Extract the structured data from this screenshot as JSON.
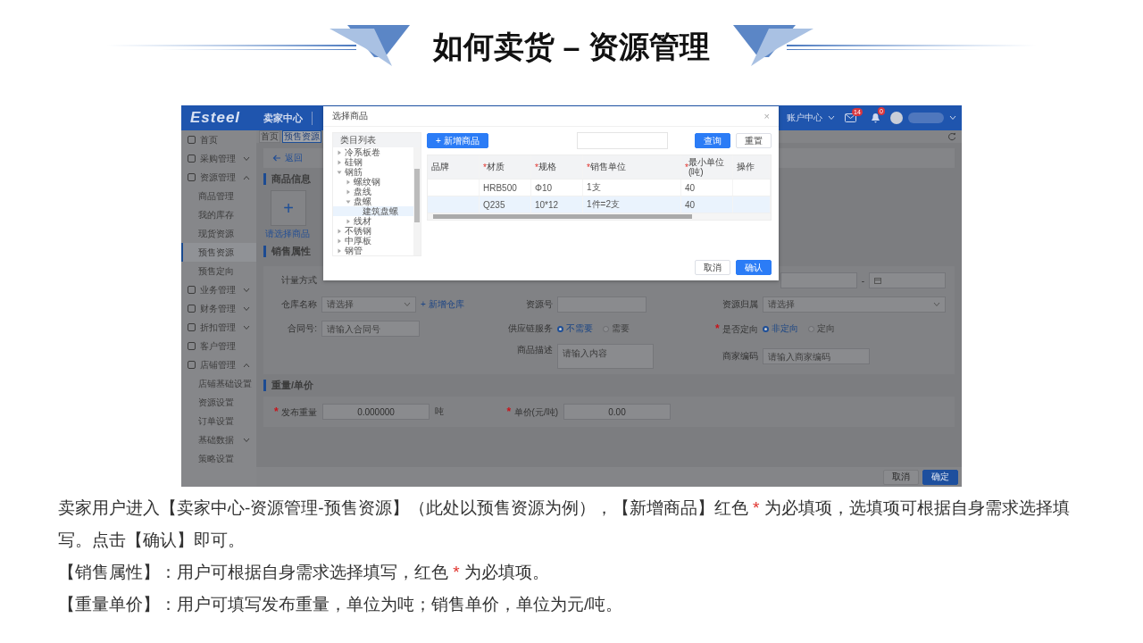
{
  "slide": {
    "title": "如何卖货 – 资源管理"
  },
  "app": {
    "topbar": {
      "logo": "Esteel",
      "center": "卖家中心",
      "account": "账户中心",
      "mail_badge": "14",
      "bell_badge": "0"
    },
    "tabs": [
      {
        "label": "首页",
        "selected": false
      },
      {
        "label": "预售资源",
        "selected": true
      }
    ],
    "sidebar": [
      {
        "label": "首页",
        "kind": "page"
      },
      {
        "label": "采购管理",
        "kind": "group",
        "expanded": false
      },
      {
        "label": "资源管理",
        "kind": "group",
        "expanded": true,
        "children": [
          {
            "label": "商品管理",
            "selected": false
          },
          {
            "label": "我的库存",
            "selected": false
          },
          {
            "label": "现货资源",
            "selected": false
          },
          {
            "label": "预售资源",
            "selected": true
          },
          {
            "label": "预售定向",
            "selected": false
          }
        ]
      },
      {
        "label": "业务管理",
        "kind": "group",
        "expanded": false
      },
      {
        "label": "财务管理",
        "kind": "group",
        "expanded": false
      },
      {
        "label": "折扣管理",
        "kind": "group",
        "expanded": false
      },
      {
        "label": "客户管理",
        "kind": "page"
      },
      {
        "label": "店铺管理",
        "kind": "group",
        "expanded": true,
        "children": [
          {
            "label": "店铺基础设置",
            "selected": false
          },
          {
            "label": "资源设置",
            "selected": false
          },
          {
            "label": "订单设置",
            "selected": false
          },
          {
            "label": "基础数据",
            "selected": false,
            "expanded": false
          },
          {
            "label": "策略设置",
            "selected": false
          }
        ]
      }
    ],
    "main": {
      "back": "返回",
      "section_goods": "商品信息",
      "add_card": {
        "symbol": "+",
        "label": "请选择商品"
      },
      "section_sales": "销售属性",
      "sales_form": {
        "measure_label": "计量方式",
        "date_range": {
          "separator": "-"
        },
        "warehouse": {
          "label": "仓库名称",
          "placeholder": "请选择",
          "link": "+ 新增仓库"
        },
        "resource_no": {
          "label": "资源号"
        },
        "resource_owner": {
          "label": "资源归属",
          "placeholder": "请选择"
        },
        "contract": {
          "label": "合同号:",
          "placeholder": "请输入合同号"
        },
        "supply": {
          "label": "供应链服务",
          "required": false,
          "options": [
            {
              "label": "不需要",
              "selected": true
            },
            {
              "label": "需要",
              "selected": false
            }
          ]
        },
        "directed": {
          "label": "是否定向",
          "required": true,
          "options": [
            {
              "label": "非定向",
              "selected": true
            },
            {
              "label": "定向",
              "selected": false
            }
          ]
        },
        "description": {
          "label": "商品描述",
          "placeholder": "请输入内容"
        },
        "merchant_code": {
          "label": "商家编码",
          "placeholder": "请输入商家编码"
        }
      },
      "section_weight": "重量/单价",
      "weight": {
        "label": "发布重量",
        "required": true,
        "value": "0.000000",
        "unit": "吨"
      },
      "price": {
        "label": "单价(元/吨)",
        "required": true,
        "value": "0.00"
      },
      "footer": [
        {
          "label": "取消",
          "kind": "secondary"
        },
        {
          "label": "确定",
          "kind": "primary"
        }
      ]
    },
    "dialog": {
      "title": "选择商品",
      "close": "×",
      "tree_header": "类目列表",
      "tree": [
        {
          "label": "冷系板卷",
          "kind": "branch",
          "expanded": false,
          "selected": false
        },
        {
          "label": "硅钢",
          "kind": "branch",
          "expanded": false,
          "selected": false
        },
        {
          "label": "钢筋",
          "kind": "branch",
          "expanded": true,
          "selected": false,
          "children": [
            {
              "label": "螺纹钢",
              "kind": "branch",
              "expanded": false,
              "selected": false
            },
            {
              "label": "盘线",
              "kind": "branch",
              "expanded": false,
              "selected": false
            },
            {
              "label": "盘螺",
              "kind": "branch",
              "expanded": true,
              "selected": false,
              "children": [
                {
                  "label": "建筑盘螺",
                  "kind": "leaf",
                  "selected": true
                }
              ]
            },
            {
              "label": "线材",
              "kind": "branch",
              "expanded": false,
              "selected": false
            }
          ]
        },
        {
          "label": "不锈钢",
          "kind": "branch",
          "expanded": false,
          "selected": false
        },
        {
          "label": "中厚板",
          "kind": "branch",
          "expanded": false,
          "selected": false
        },
        {
          "label": "钢管",
          "kind": "branch",
          "expanded": false,
          "selected": false
        }
      ],
      "add_button": "+ 新增商品",
      "query": "查询",
      "reset": "重置",
      "columns": [
        {
          "label": "品牌",
          "required": false
        },
        {
          "label": "材质",
          "required": true
        },
        {
          "label": "规格",
          "required": true
        },
        {
          "label": "销售单位",
          "required": true
        },
        {
          "label": "最小单位(吨)",
          "required": true
        },
        {
          "label": "操作",
          "required": false
        }
      ],
      "rows": [
        {
          "material": "HRB500",
          "spec": "Φ10",
          "unit": "1支",
          "min": "40",
          "selected": false
        },
        {
          "material": "Q235",
          "spec": "10*12",
          "unit": "1件=2支",
          "min": "40",
          "selected": true
        }
      ],
      "buttons": [
        {
          "label": "取消",
          "kind": "secondary"
        },
        {
          "label": "确认",
          "kind": "primary"
        }
      ]
    }
  },
  "notes": [
    {
      "parts": [
        {
          "text": "卖家用户进入【卖家中心-资源管理-预售资源】（此处以预售资源为例），【新增商品】红色 ",
          "kind": "plain"
        },
        {
          "text": "*",
          "kind": "required"
        },
        {
          "text": " 为必填项，选填项可根据自身需求选择填写。点击【确认】即可。",
          "kind": "plain"
        }
      ]
    },
    {
      "parts": [
        {
          "text": "【销售属性】：用户可根据自身需求选择填写，红色 ",
          "kind": "plain"
        },
        {
          "text": "*",
          "kind": "required"
        },
        {
          "text": " 为必填项。",
          "kind": "plain"
        }
      ]
    },
    {
      "parts": [
        {
          "text": "【重量单价】：用户可填写发布重量，单位为吨；销售单价，单位为元/吨。",
          "kind": "plain"
        }
      ]
    }
  ]
}
